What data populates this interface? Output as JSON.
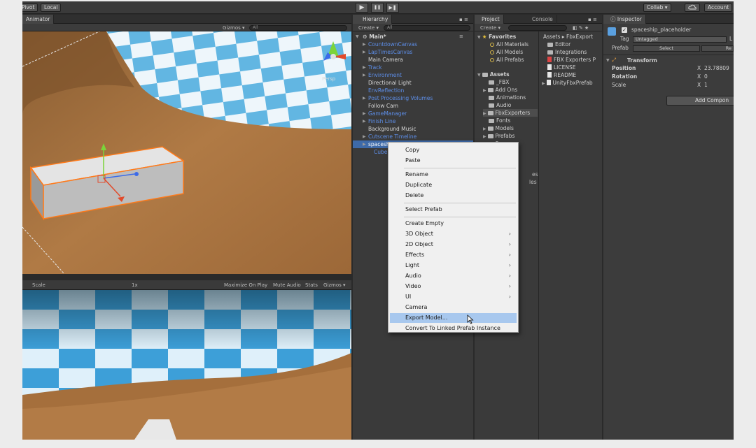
{
  "toolbar": {
    "pivot": "Pivot",
    "local": "Local",
    "collab": "Collab ▾",
    "account": "Account",
    "play": "▶",
    "pause": "❚❚",
    "step": "▶❚"
  },
  "scene": {
    "tab": "Animator",
    "gizmos": "Gizmos ▾",
    "search": "All",
    "persp": "Persp"
  },
  "game": {
    "scale_label": "Scale",
    "scale_value": "1x",
    "maximize": "Maximize On Play",
    "mute": "Mute Audio",
    "stats": "Stats",
    "gizmos": "Gizmos ▾"
  },
  "hierarchy": {
    "tab": "Hierarchy",
    "create": "Create ▾",
    "search": "All",
    "root": "Main*",
    "items": [
      {
        "label": "CountdownCanvas",
        "color": "blue",
        "arrow": true
      },
      {
        "label": "LapTimesCanvas",
        "color": "blue",
        "arrow": true
      },
      {
        "label": "Main Camera",
        "color": "white",
        "arrow": false
      },
      {
        "label": "Track",
        "color": "blue",
        "arrow": true
      },
      {
        "label": "Environment",
        "color": "blue",
        "arrow": true
      },
      {
        "label": "Directional Light",
        "color": "white",
        "arrow": false
      },
      {
        "label": "EnvReflection",
        "color": "blue",
        "arrow": false
      },
      {
        "label": "Post Processing Volumes",
        "color": "blue",
        "arrow": true
      },
      {
        "label": "Follow Cam",
        "color": "white",
        "arrow": false
      },
      {
        "label": "GameManager",
        "color": "blue",
        "arrow": true
      },
      {
        "label": "Finish Line",
        "color": "blue",
        "arrow": true
      },
      {
        "label": "Background Music",
        "color": "white",
        "arrow": false
      },
      {
        "label": "Cutscene Timeline",
        "color": "blue",
        "arrow": true
      },
      {
        "label": "spaceship_placeholder",
        "color": "white",
        "arrow": true,
        "selected": true
      },
      {
        "label": "Cube",
        "color": "blue",
        "arrow": false,
        "indent": true
      }
    ]
  },
  "project": {
    "tab": "Project",
    "console_tab": "Console",
    "create": "Create ▾",
    "breadcrumb": "Assets ▸ FbxExport",
    "favorites_label": "Favorites",
    "favorites": [
      "All Materials",
      "All Models",
      "All Prefabs"
    ],
    "assets_label": "Assets",
    "folders": [
      "_FBX",
      "Add Ons",
      "Animations",
      "Audio",
      "FbxExporters",
      "Fonts",
      "Models",
      "Prefabs",
      "Scenes"
    ],
    "folder_extra_1": "es",
    "folder_extra_2": "les",
    "files": [
      {
        "label": "Editor",
        "icon": "folder"
      },
      {
        "label": "Integrations",
        "icon": "folder"
      },
      {
        "label": "FBX Exporters P",
        "icon": "pdf"
      },
      {
        "label": "LICENSE",
        "icon": "file"
      },
      {
        "label": "README",
        "icon": "file"
      },
      {
        "label": "UnityFbxPrefab",
        "icon": "file"
      }
    ]
  },
  "inspector": {
    "tab": "Inspector",
    "object_name": "spaceship_placeholder",
    "tag_label": "Tag",
    "tag_value": "Untagged",
    "layer_letter": "L",
    "prefab_label": "Prefab",
    "prefab_select": "Select",
    "prefab_revert": "Re",
    "transform_label": "Transform",
    "position_label": "Position",
    "position_axis": "X",
    "position_value": "23.78809",
    "rotation_label": "Rotation",
    "rotation_axis": "X",
    "rotation_value": "0",
    "scale_label": "Scale",
    "scale_axis": "X",
    "scale_value": "1",
    "add_component": "Add Compon"
  },
  "context_menu": {
    "items": [
      {
        "label": "Copy",
        "submenu": false
      },
      {
        "label": "Paste",
        "submenu": false
      },
      {
        "sep": true
      },
      {
        "label": "Rename",
        "submenu": false
      },
      {
        "label": "Duplicate",
        "submenu": false
      },
      {
        "label": "Delete",
        "submenu": false
      },
      {
        "sep": true
      },
      {
        "label": "Select Prefab",
        "submenu": false
      },
      {
        "sep": true
      },
      {
        "label": "Create Empty",
        "submenu": false
      },
      {
        "label": "3D Object",
        "submenu": true
      },
      {
        "label": "2D Object",
        "submenu": true
      },
      {
        "label": "Effects",
        "submenu": true
      },
      {
        "label": "Light",
        "submenu": true
      },
      {
        "label": "Audio",
        "submenu": true
      },
      {
        "label": "Video",
        "submenu": true
      },
      {
        "label": "UI",
        "submenu": true
      },
      {
        "label": "Camera",
        "submenu": false
      },
      {
        "label": "Export Model...",
        "submenu": false,
        "highlighted": true
      },
      {
        "label": "Convert To Linked Prefab Instance",
        "submenu": false
      }
    ],
    "submenu_glyph": "›"
  },
  "colors": {
    "highlight": "#a8c8ee",
    "selection": "#3e6aa8",
    "blue_text": "#5d8ee8"
  }
}
